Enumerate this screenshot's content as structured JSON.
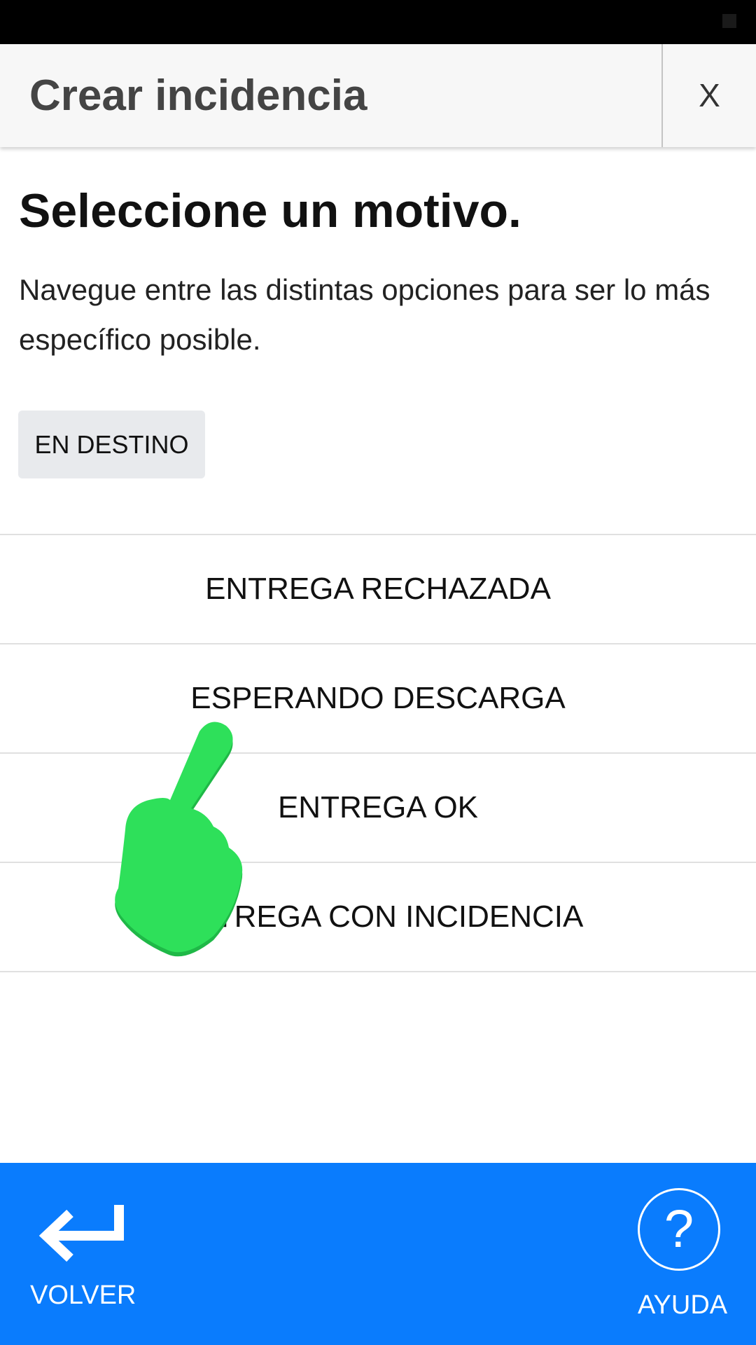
{
  "header": {
    "title": "Crear incidencia",
    "close_label": "X"
  },
  "main": {
    "heading": "Seleccione un motivo.",
    "description": "Navegue entre las distintas opciones para ser lo más específico posible.",
    "selected_category": "EN DESTINO",
    "options": [
      {
        "label": "ENTREGA RECHAZADA"
      },
      {
        "label": "ESPERANDO DESCARGA"
      },
      {
        "label": "ENTREGA OK"
      },
      {
        "label": "ENTREGA CON INCIDENCIA"
      }
    ]
  },
  "overlay": {
    "icon": "pointing-hand-icon",
    "color": "#2ee05a"
  },
  "footer": {
    "back_label": "VOLVER",
    "back_icon": "return-arrow-icon",
    "help_label": "AYUDA",
    "help_icon": "question-circle-icon",
    "help_glyph": "?",
    "background_color": "#0a7cfd"
  }
}
